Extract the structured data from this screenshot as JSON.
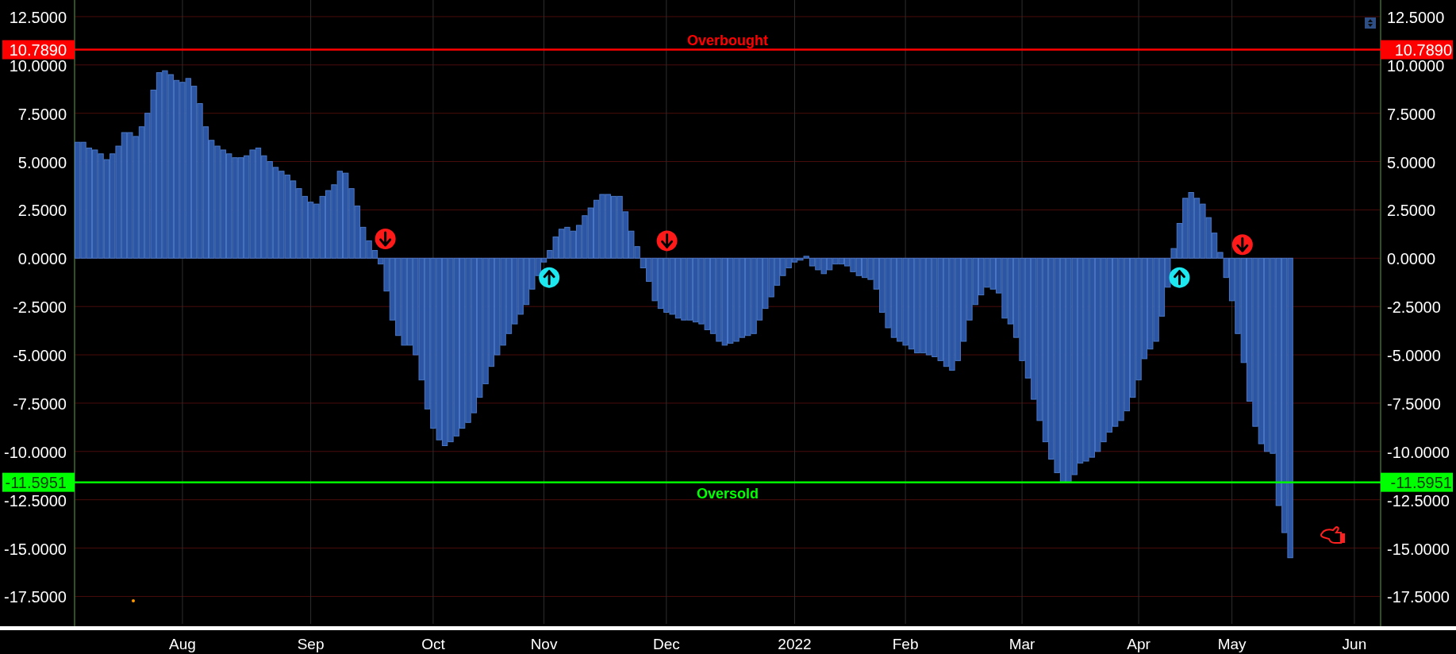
{
  "chart_data": {
    "type": "bar",
    "orientation": "vertical",
    "grid": true,
    "ylim": [
      -18.92,
      13.36
    ],
    "yticks": [
      {
        "value": 12.5,
        "label": "12.5000"
      },
      {
        "value": 10,
        "label": "10.0000"
      },
      {
        "value": 7.5,
        "label": "7.5000"
      },
      {
        "value": 5,
        "label": "5.0000"
      },
      {
        "value": 2.5,
        "label": "2.5000"
      },
      {
        "value": 0,
        "label": "0.0000"
      },
      {
        "value": -2.5,
        "label": "-2.5000"
      },
      {
        "value": -5,
        "label": "-5.0000"
      },
      {
        "value": -7.5,
        "label": "-7.5000"
      },
      {
        "value": -10,
        "label": "-10.0000"
      },
      {
        "value": -12.5,
        "label": "-12.5000"
      },
      {
        "value": -15,
        "label": "-15.0000"
      },
      {
        "value": -17.5,
        "label": "-17.5000"
      }
    ],
    "categories": [
      null,
      null,
      null,
      null,
      null,
      null,
      null,
      null,
      null,
      null,
      null,
      null,
      null,
      null,
      null,
      null,
      null,
      null,
      "Aug",
      null,
      null,
      null,
      null,
      null,
      null,
      null,
      null,
      null,
      null,
      null,
      null,
      null,
      null,
      null,
      null,
      null,
      null,
      null,
      null,
      null,
      "Sep",
      null,
      null,
      null,
      null,
      null,
      null,
      null,
      null,
      null,
      null,
      null,
      null,
      null,
      null,
      null,
      null,
      null,
      null,
      null,
      null,
      "Oct",
      null,
      null,
      null,
      null,
      null,
      null,
      null,
      null,
      null,
      null,
      null,
      null,
      null,
      null,
      null,
      null,
      null,
      null,
      "Nov",
      null,
      null,
      null,
      null,
      null,
      null,
      null,
      null,
      null,
      null,
      null,
      null,
      null,
      null,
      null,
      null,
      null,
      null,
      null,
      null,
      "Dec",
      null,
      null,
      null,
      null,
      null,
      null,
      null,
      null,
      null,
      null,
      null,
      null,
      null,
      null,
      null,
      null,
      null,
      null,
      null,
      null,
      null,
      "2022",
      null,
      null,
      null,
      null,
      null,
      null,
      null,
      null,
      null,
      null,
      null,
      null,
      null,
      null,
      null,
      null,
      null,
      null,
      "Feb",
      null,
      null,
      null,
      null,
      null,
      null,
      null,
      null,
      null,
      null,
      null,
      null,
      null,
      null,
      null,
      null,
      null,
      null,
      null,
      "Mar",
      null,
      null,
      null,
      null,
      null,
      null,
      null,
      null,
      null,
      null,
      null,
      null,
      null,
      null,
      null,
      null,
      null,
      null,
      null,
      "Apr",
      null,
      null,
      null,
      null,
      null,
      null,
      null,
      null,
      null,
      null,
      null,
      null,
      null,
      null,
      null,
      "May",
      null,
      null,
      null,
      null,
      null,
      null,
      null,
      null,
      null,
      null,
      null,
      null,
      null,
      null,
      null,
      null,
      null,
      null,
      null,
      null,
      "Jun",
      null,
      null,
      null,
      null
    ],
    "series": [
      {
        "color": "#2c56a3",
        "values": [
          6.0,
          6.0,
          5.7,
          5.6,
          5.4,
          5.1,
          5.4,
          5.8,
          6.5,
          6.5,
          6.3,
          6.8,
          7.5,
          8.7,
          9.6,
          9.7,
          9.5,
          9.2,
          9.1,
          9.3,
          8.9,
          8.0,
          6.8,
          6.1,
          5.8,
          5.6,
          5.4,
          5.2,
          5.2,
          5.3,
          5.6,
          5.7,
          5.3,
          5.0,
          4.7,
          4.5,
          4.3,
          4.0,
          3.6,
          3.2,
          2.9,
          2.8,
          3.2,
          3.5,
          3.8,
          4.5,
          4.4,
          3.6,
          2.7,
          1.6,
          0.9,
          0.4,
          -0.3,
          -1.7,
          -3.2,
          -4.0,
          -4.5,
          -4.5,
          -5.0,
          -6.3,
          -7.8,
          -8.8,
          -9.4,
          -9.7,
          -9.5,
          -9.2,
          -8.8,
          -8.5,
          -8.0,
          -7.2,
          -6.5,
          -5.6,
          -5.0,
          -4.5,
          -3.9,
          -3.4,
          -2.9,
          -2.4,
          -1.6,
          -0.9,
          -0.2,
          0.4,
          1.1,
          1.5,
          1.6,
          1.4,
          1.7,
          2.2,
          2.6,
          3.0,
          3.3,
          3.3,
          3.2,
          3.2,
          2.4,
          1.4,
          0.6,
          -0.5,
          -1.2,
          -2.2,
          -2.6,
          -2.8,
          -2.9,
          -3.1,
          -3.2,
          -3.2,
          -3.3,
          -3.4,
          -3.7,
          -3.9,
          -4.3,
          -4.5,
          -4.4,
          -4.3,
          -4.1,
          -4.0,
          -3.9,
          -3.2,
          -2.6,
          -2.0,
          -1.4,
          -0.9,
          -0.5,
          -0.2,
          -0.1,
          0.1,
          -0.4,
          -0.6,
          -0.8,
          -0.6,
          -0.3,
          -0.3,
          -0.4,
          -0.7,
          -0.9,
          -1.0,
          -1.1,
          -1.6,
          -2.8,
          -3.6,
          -4.1,
          -4.3,
          -4.5,
          -4.7,
          -4.9,
          -4.9,
          -5.0,
          -5.1,
          -5.3,
          -5.6,
          -5.8,
          -5.3,
          -4.3,
          -3.2,
          -2.4,
          -1.9,
          -1.5,
          -1.6,
          -1.8,
          -3.1,
          -3.4,
          -4.1,
          -5.3,
          -6.2,
          -7.3,
          -8.4,
          -9.5,
          -10.4,
          -11.1,
          -11.6,
          -11.6,
          -11.2,
          -10.6,
          -10.5,
          -10.3,
          -10.0,
          -9.5,
          -9.0,
          -8.7,
          -8.4,
          -7.9,
          -7.2,
          -6.3,
          -5.2,
          -4.7,
          -4.3,
          -3.0,
          -1.5,
          0.5,
          1.8,
          3.1,
          3.4,
          3.1,
          2.8,
          2.1,
          1.3,
          0.3,
          -1.0,
          -2.2,
          -3.9,
          -5.4,
          -7.4,
          -8.7,
          -9.6,
          -10.0,
          -10.1,
          -12.8,
          -14.2,
          -15.5,
          null,
          null,
          null,
          null,
          null,
          null,
          null,
          null,
          null,
          null,
          null,
          null,
          null,
          null,
          null
        ]
      }
    ],
    "ref_lines": [
      {
        "axis": "y",
        "value": 10.789,
        "label": "Overbought",
        "color": "#ff0000"
      },
      {
        "axis": "y",
        "value": -11.5951,
        "label": "Oversold",
        "color": "#00ff00"
      }
    ]
  },
  "left_axis_badges": [
    {
      "text": "10.7890",
      "color": "#ff0000"
    },
    {
      "text": "-11.5951",
      "color": "#00ff00"
    }
  ],
  "right_axis_badges": [
    {
      "text": "10.7890",
      "color": "#ff0000"
    },
    {
      "text": "-11.5951",
      "color": "#00ff00"
    }
  ]
}
